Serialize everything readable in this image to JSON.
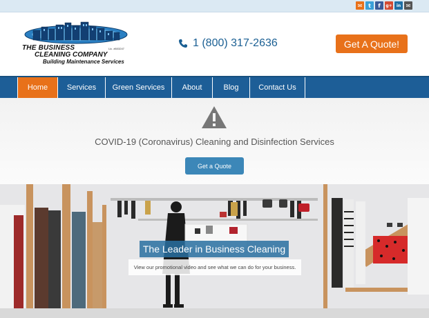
{
  "social": [
    {
      "icon": "email-icon",
      "glyph": "✉",
      "color": "#e8711a"
    },
    {
      "icon": "twitter-icon",
      "glyph": "t",
      "color": "#3aa0d8"
    },
    {
      "icon": "facebook-icon",
      "glyph": "f",
      "color": "#3b5b98"
    },
    {
      "icon": "google-plus-icon",
      "glyph": "g+",
      "color": "#d34a32"
    },
    {
      "icon": "linkedin-icon",
      "glyph": "in",
      "color": "#1f6fa5"
    },
    {
      "icon": "envelope-icon",
      "glyph": "✉",
      "color": "#555555"
    }
  ],
  "logo": {
    "line1": "THE BUSINESS",
    "line2": "CLEANING COMPANY",
    "line3": "Building Maintenance Services",
    "license": "Lic. #603247"
  },
  "header": {
    "phone": "1 (800) 317-2636",
    "quote_button": "Get A Quote!"
  },
  "nav": {
    "items": [
      {
        "label": "Home",
        "active": true
      },
      {
        "label": "Services",
        "active": false
      },
      {
        "label": "Green Services",
        "active": false
      },
      {
        "label": "About",
        "active": false
      },
      {
        "label": "Blog",
        "active": false
      },
      {
        "label": "Contact Us",
        "active": false
      }
    ]
  },
  "covid": {
    "title": "COVID-19 (Coronavirus) Cleaning and Disinfection Services",
    "button": "Get a Quote"
  },
  "hero": {
    "title": "The Leader in Business Cleaning",
    "subtitle": "View our promotional video and see what we can do for your business."
  },
  "colors": {
    "brand_blue": "#1d5e97",
    "accent_orange": "#e8711a",
    "button_blue": "#3c87b8"
  }
}
